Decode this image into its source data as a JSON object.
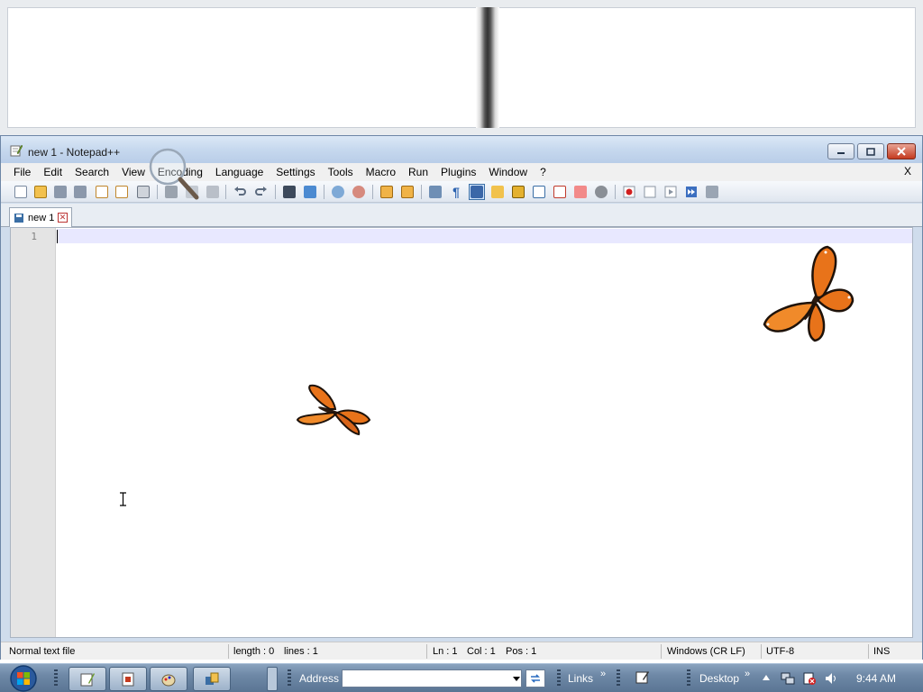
{
  "window": {
    "title": "new 1 - Notepad++",
    "menu_close": "X"
  },
  "menu": [
    "File",
    "Edit",
    "Search",
    "View",
    "Encoding",
    "Language",
    "Settings",
    "Tools",
    "Macro",
    "Run",
    "Plugins",
    "Window",
    "?"
  ],
  "tabs": [
    {
      "label": "new 1",
      "active": true
    }
  ],
  "editor": {
    "line_numbers": [
      "1"
    ],
    "content": ""
  },
  "statusbar": {
    "file_type": "Normal text file",
    "length": "length : 0",
    "lines": "lines : 1",
    "ln": "Ln : 1",
    "col": "Col : 1",
    "pos": "Pos : 1",
    "eol": "Windows (CR LF)",
    "encoding": "UTF-8",
    "mode": "INS"
  },
  "taskbar": {
    "address_label": "Address",
    "address_value": "",
    "links_label": "Links",
    "desktop_label": "Desktop",
    "clock": "9:44 AM"
  },
  "colors": {
    "titlebar": "#c6d8ee",
    "current_line": "#e8e8ff",
    "gutter": "#e4e4e4",
    "taskbar": "#6e88a6",
    "butterfly": "#e8731a"
  }
}
